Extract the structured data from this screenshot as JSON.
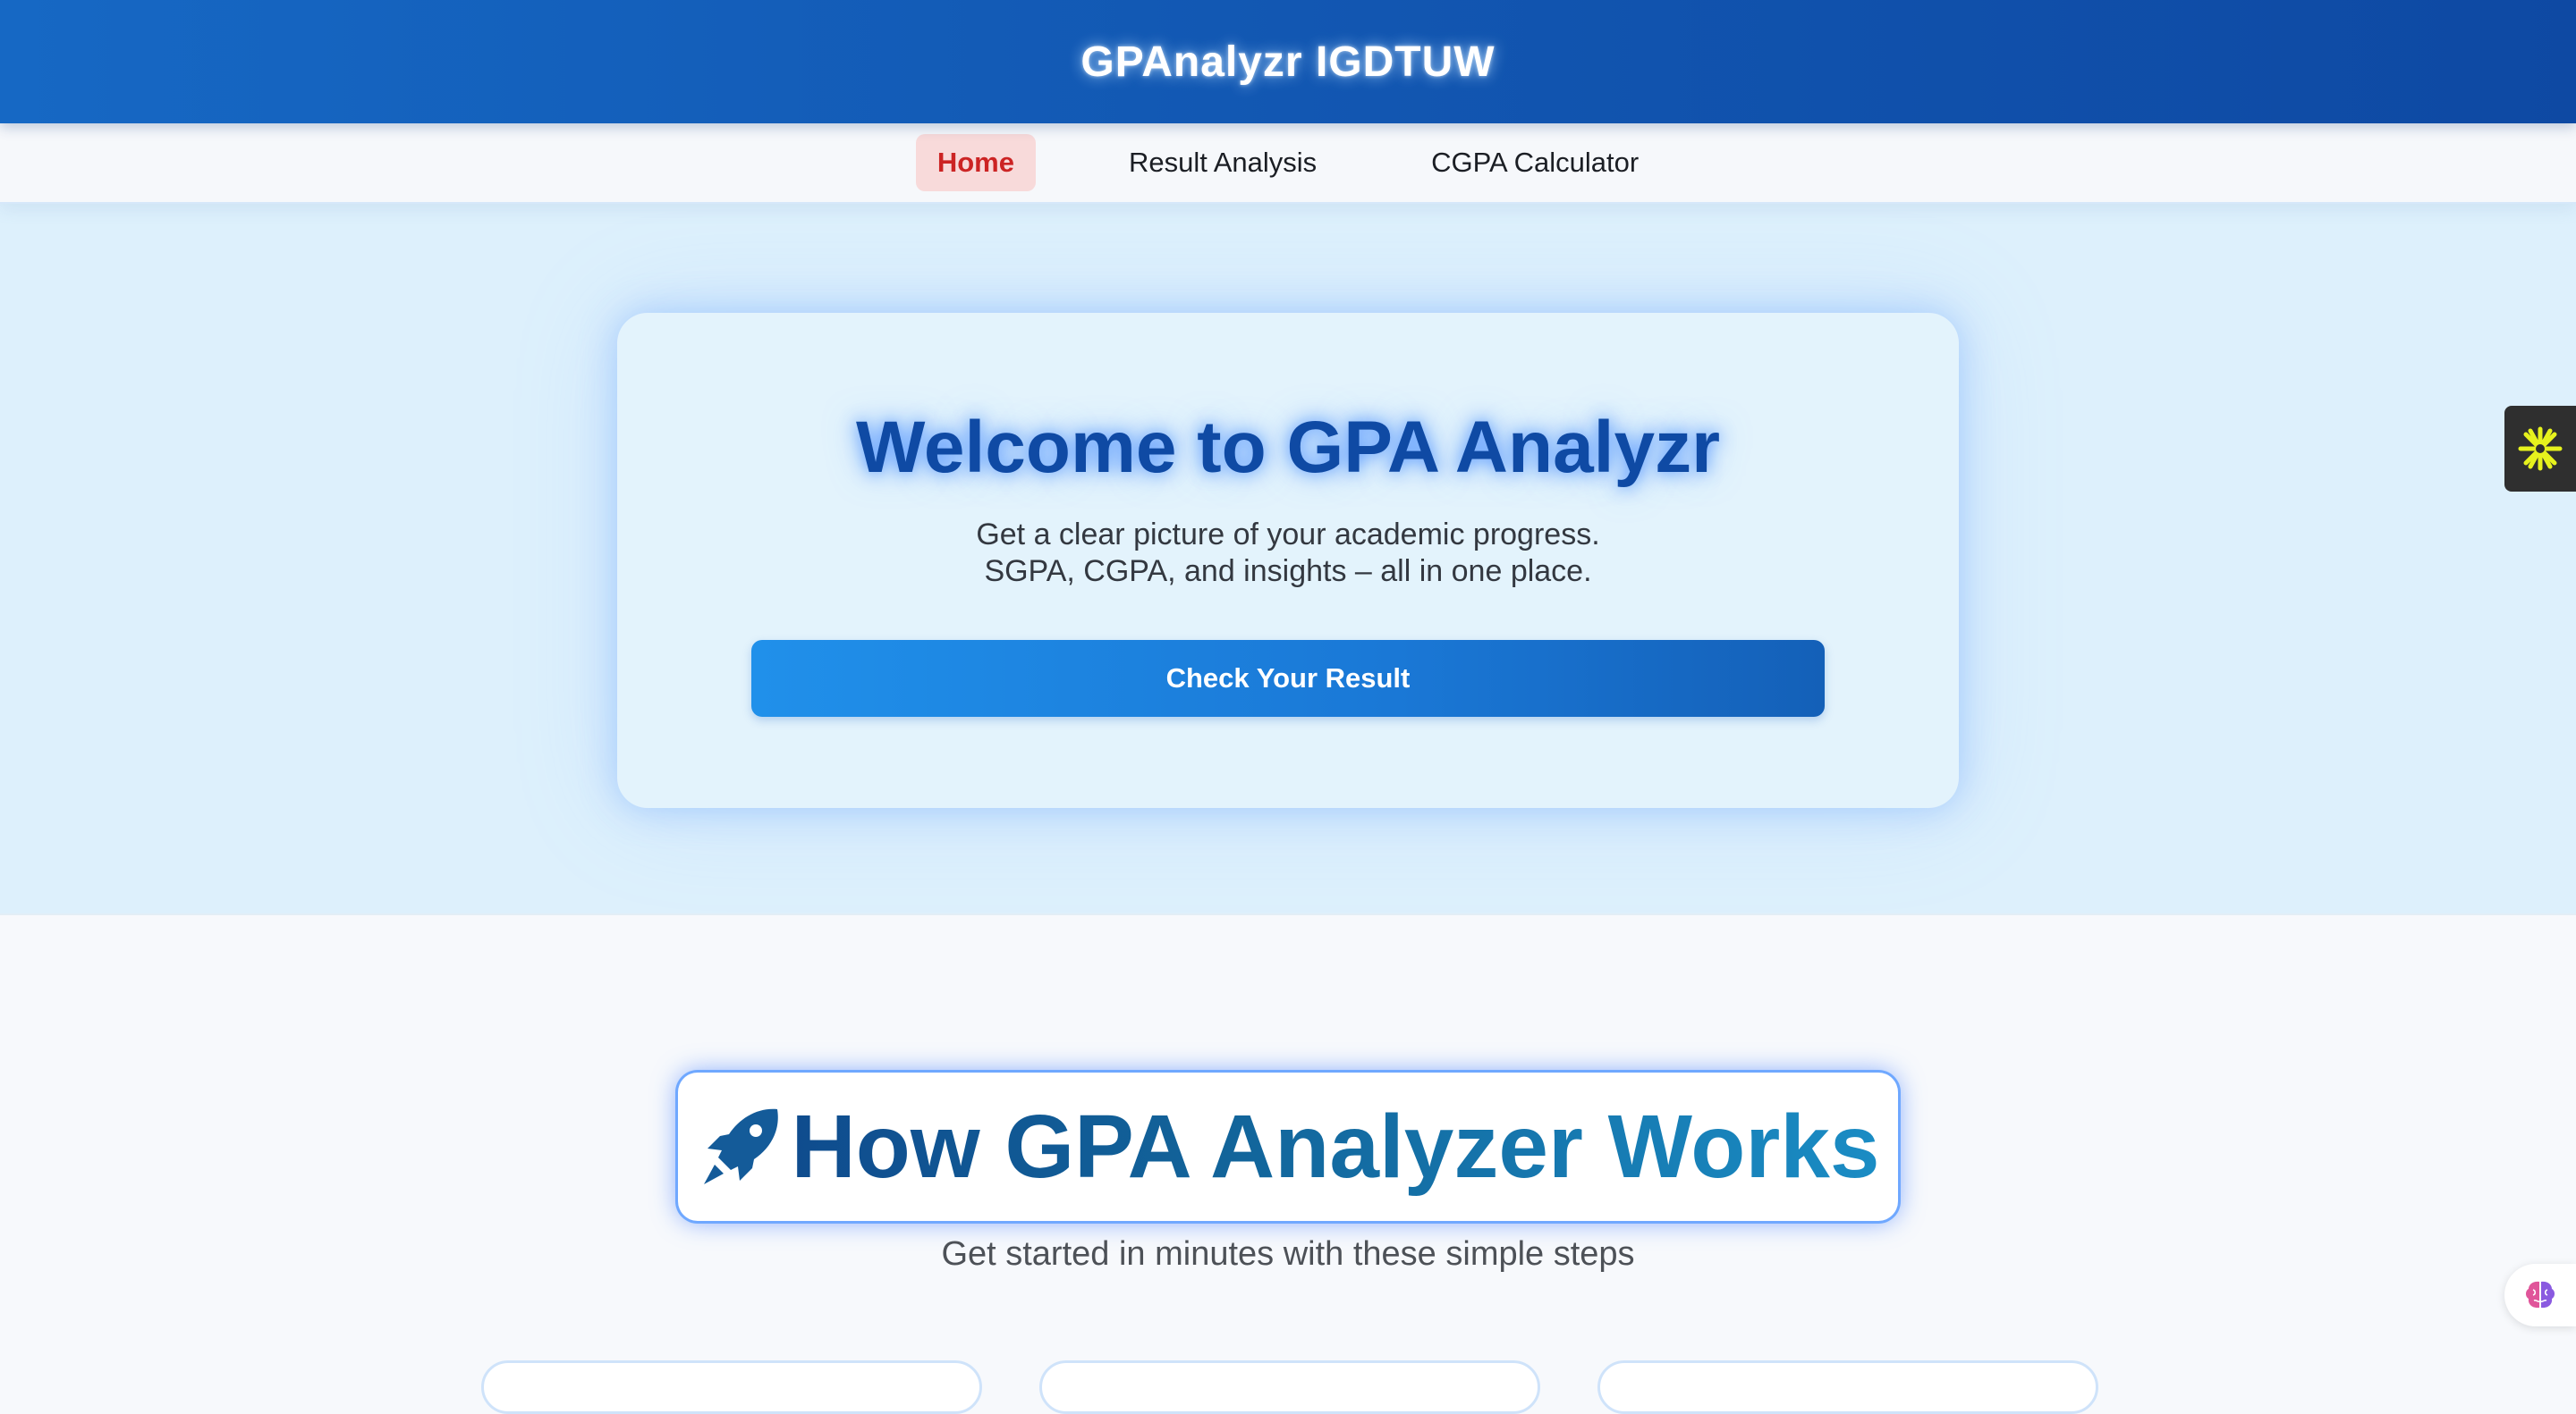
{
  "header": {
    "brand": "GPAnalyzr IGDTUW"
  },
  "nav": {
    "items": [
      {
        "label": "Home",
        "active": true
      },
      {
        "label": "Result Analysis",
        "active": false
      },
      {
        "label": "CGPA Calculator",
        "active": false
      }
    ]
  },
  "hero": {
    "title": "Welcome to GPA Analyzr",
    "subtitle_line1": "Get a clear picture of your academic progress.",
    "subtitle_line2": "SGPA, CGPA, and insights – all in one place.",
    "cta_label": "Check Your Result"
  },
  "how": {
    "icon": "rocket-icon",
    "title": "How GPA Analyzer Works",
    "subtitle": "Get started in minutes with these simple steps"
  },
  "widgets": {
    "side_icon": "asterisk-icon",
    "floating_icon": "brain-icon"
  },
  "colors": {
    "header": "#1257b2",
    "hero_bg": "#ddf0fc",
    "active_nav_bg": "#f8dada",
    "active_nav_text": "#cc2424",
    "cta": "#1a78d6",
    "title": "#0f4aa4"
  }
}
